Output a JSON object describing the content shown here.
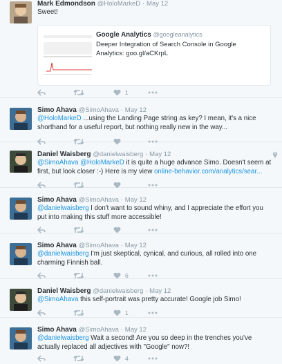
{
  "colors": {
    "link": "#1b95e0",
    "muted": "#8899a6",
    "background": "#f5f8fa",
    "divider": "#e1e8ed"
  },
  "tweets": [
    {
      "name": "Mark Edmondson",
      "handle": "@HoloMarkeD",
      "time": "May 12",
      "text": "Sweet!",
      "card": {
        "title": "Google Analytics",
        "handle": "@googleanalytics",
        "description": "Deeper Integration of Search Console in Google Analytics: goo.gl/aCKrpL"
      },
      "like_count": "1"
    },
    {
      "name": "Simo Ahava",
      "handle": "@SimoAhava",
      "time": "May 12",
      "mention": "@HoloMarkeD",
      "text": "...using the Landing Page string as key? I mean, it's a nice shorthand for a useful report, but nothing really new in the way..."
    },
    {
      "name": "Daniel Waisberg",
      "handle": "@danielwaisberg",
      "time": "May 12",
      "mention": "@SimoAhava @HoloMarkeD",
      "text": "it is quite a huge advance Simo. Doesn't seem at first, but look closer :-) Here is my view",
      "link": "online-behavior.com/analytics/sear..."
    },
    {
      "name": "Simo Ahava",
      "handle": "@SimoAhava",
      "time": "May 12",
      "mention": "@danielwaisberg",
      "text": "I don't want to sound whiny, and I appreciate the effort you put into making this stuff more accessible!"
    },
    {
      "name": "Simo Ahava",
      "handle": "@SimoAhava",
      "time": "May 12",
      "mention": "@danielwaisberg",
      "text": "I'm just skeptical, cynical, and curious, all rolled into one charming Finnish ball.",
      "like_count": "6"
    },
    {
      "name": "Daniel Waisberg",
      "handle": "@danielwaisberg",
      "time": "May 12",
      "mention": "@SimoAhava",
      "text": "this self-portrait was pretty accurate! Google job Simo!",
      "like_count": "1"
    },
    {
      "name": "Simo Ahava",
      "handle": "@SimoAhava",
      "time": "May 12",
      "mention": "@danielwaisberg",
      "text": "Wait a second! Are you so deep in the trenches you've actually replaced all adjectives with \"Google\" now?!",
      "like_count": "4"
    }
  ]
}
